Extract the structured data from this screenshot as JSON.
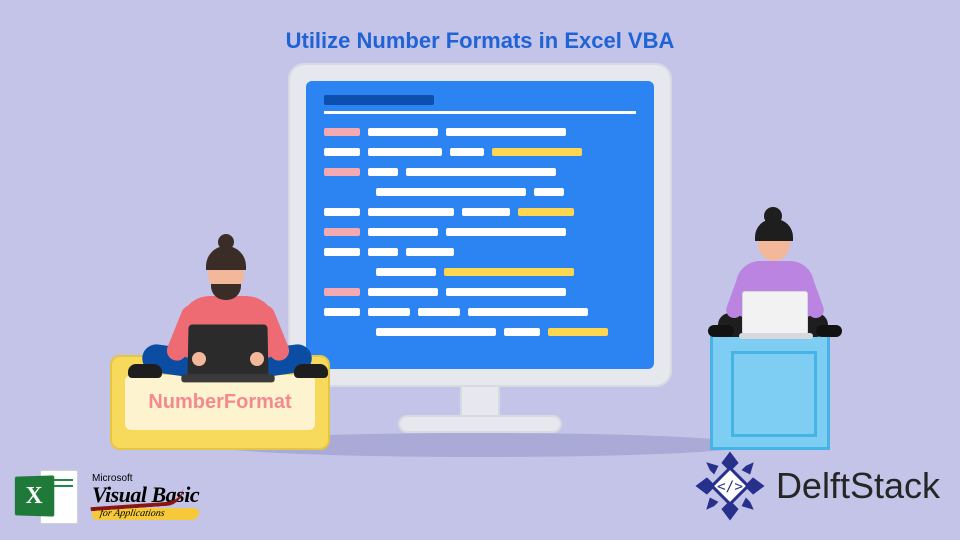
{
  "title": "Utilize Number Formats in Excel VBA",
  "left": {
    "box_label": "NumberFormat"
  },
  "logos": {
    "excel_letter": "X",
    "vb_ms": "Microsoft",
    "vb_name": "Visual Basic",
    "vb_apps": "for Applications"
  },
  "brand": {
    "name": "DelftStack",
    "tag_content": "</>"
  },
  "colors": {
    "bg": "#c3c4e8",
    "accent_blue": "#2c84f3",
    "title_blue": "#1f63d6",
    "pink": "#f5a9b0",
    "yellow": "#ffd650",
    "box_yellow": "#f7d95b",
    "cube_blue": "#7ecdf3",
    "excel_green": "#1f7a3a"
  }
}
